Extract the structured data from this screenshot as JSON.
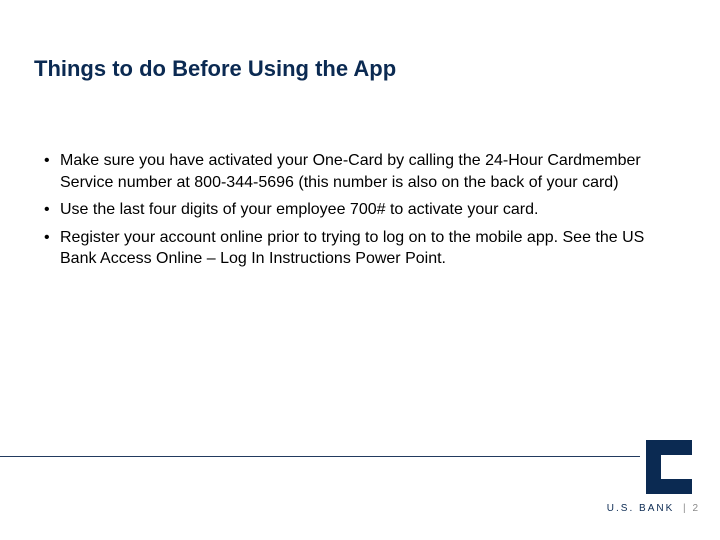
{
  "title": "Things to do Before Using the App",
  "bullets": [
    "Make sure you have activated your One-Card by calling the 24-Hour Cardmember Service number at 800-344-5696 (this number is also on the back of your card)",
    "Use the last four digits of your employee 700# to activate your card.",
    "Register your account online prior to trying to log on to the mobile app. See the US Bank Access Online – Log In Instructions Power Point."
  ],
  "footer": {
    "brand": "U.S. BANK",
    "separator": "|",
    "page": "2"
  },
  "colors": {
    "brand_navy": "#0b2a52"
  }
}
